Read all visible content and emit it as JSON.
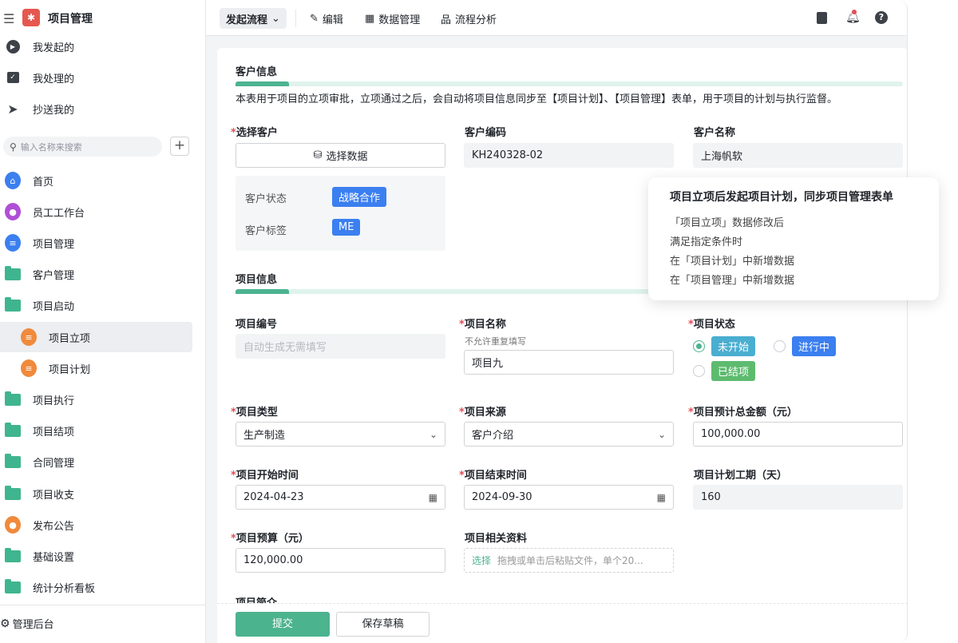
{
  "app": {
    "title": "项目管理"
  },
  "sidebar": {
    "quick": [
      {
        "label": "我发起的"
      },
      {
        "label": "我处理的"
      },
      {
        "label": "抄送我的"
      }
    ],
    "search_placeholder": "输入名称来搜索",
    "items": [
      {
        "label": "首页",
        "icon": "home-icon",
        "color": "#3b7ff0"
      },
      {
        "label": "员工工作台",
        "icon": "user-icon",
        "color": "#b04fd6"
      },
      {
        "label": "项目管理",
        "icon": "doc-icon",
        "color": "#3b7ff0"
      },
      {
        "label": "客户管理",
        "icon": "folder-icon"
      },
      {
        "label": "项目启动",
        "icon": "folder-open-icon"
      },
      {
        "label": "项目立项",
        "icon": "doc-icon",
        "color": "#f08a3c",
        "child": true,
        "selected": true
      },
      {
        "label": "项目计划",
        "icon": "doc-icon",
        "color": "#f08a3c",
        "child": true
      },
      {
        "label": "项目执行",
        "icon": "folder-icon"
      },
      {
        "label": "项目结项",
        "icon": "folder-icon"
      },
      {
        "label": "合同管理",
        "icon": "folder-icon"
      },
      {
        "label": "项目收支",
        "icon": "folder-icon"
      },
      {
        "label": "发布公告",
        "icon": "user-icon",
        "color": "#f08a3c"
      },
      {
        "label": "基础设置",
        "icon": "folder-icon"
      },
      {
        "label": "统计分析看板",
        "icon": "folder-icon"
      }
    ],
    "footer": "管理后台"
  },
  "topbar": {
    "launch": "发起流程",
    "edit": "编辑",
    "data": "数据管理",
    "analysis": "流程分析"
  },
  "form": {
    "customer_section": "客户信息",
    "description": "本表用于项目的立项审批，立项通过之后，会自动将项目信息同步至【项目计划】、【项目管理】表单，用于项目的计划与执行监督。",
    "select_customer_label": "选择客户",
    "select_data_btn": "选择数据",
    "customer_code_label": "客户编码",
    "customer_code": "KH240328-02",
    "customer_name_label": "客户名称",
    "customer_name": "上海帆软",
    "customer_status_label": "客户状态",
    "customer_status": "战略合作",
    "customer_tag_label": "客户标签",
    "customer_tag": "ME",
    "project_section": "项目信息",
    "project_no_label": "项目编号",
    "project_no_placeholder": "自动生成无需填写",
    "project_name_label": "项目名称",
    "project_name_hint": "不允许重复填写",
    "project_name": "项目九",
    "project_status_label": "项目状态",
    "status_options": [
      {
        "label": "未开始",
        "color": "#4aaed0",
        "checked": true
      },
      {
        "label": "进行中",
        "color": "#3b7ff0"
      },
      {
        "label": "已结项",
        "color": "#5dbb6f"
      }
    ],
    "project_type_label": "项目类型",
    "project_type": "生产制造",
    "project_source_label": "项目来源",
    "project_source": "客户介绍",
    "total_amount_label": "项目预计总金额（元）",
    "total_amount": "100,000.00",
    "start_label": "项目开始时间",
    "start": "2024-04-23",
    "end_label": "项目结束时间",
    "end": "2024-09-30",
    "duration_label": "项目计划工期（天）",
    "duration": "160",
    "budget_label": "项目预算（元）",
    "budget": "120,000.00",
    "attach_label": "项目相关资料",
    "attach_select": "选择",
    "attach_hint": "拖拽或单击后粘贴文件，单个20...",
    "intro_label": "项目简介",
    "submit": "提交",
    "save_draft": "保存草稿"
  },
  "tooltip": {
    "title": "项目立项后发起项目计划，同步项目管理表单",
    "lines": [
      "「项目立项」数据修改后",
      "满足指定条件时",
      "在「项目计划」中新增数据",
      "在「项目管理」中新增数据"
    ]
  }
}
